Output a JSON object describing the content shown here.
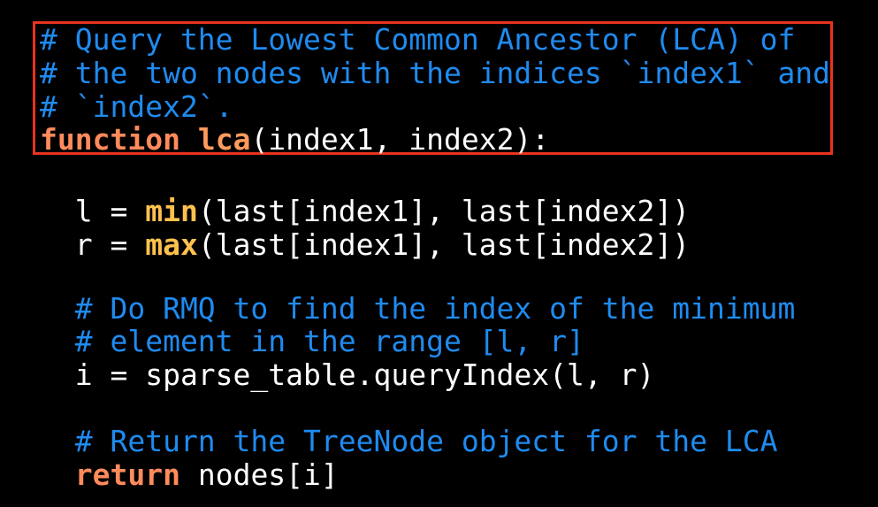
{
  "code": {
    "comment_line_1": "# Query the Lowest Common Ancestor (LCA) of",
    "comment_line_2": "# the two nodes with the indices `index1` and",
    "comment_line_3": "# `index2`.",
    "func_keyword": "function",
    "func_name": "lca",
    "func_params": "(index1, index2):",
    "l_prefix": "  l = ",
    "min_builtin": "min",
    "l_args": "(last[index1], last[index2])",
    "r_prefix": "  r = ",
    "max_builtin": "max",
    "r_args": "(last[index1], last[index2])",
    "comment_line_4": "  # Do RMQ to find the index of the minimum",
    "comment_line_5": "  # element in the range [l, r]",
    "i_line": "  i = sparse_table.queryIndex(l, r)",
    "comment_line_6": "  # Return the TreeNode object for the LCA",
    "return_indent": "  ",
    "return_keyword": "return",
    "return_value": " nodes[i]"
  },
  "colors": {
    "background": "#000000",
    "comment": "#1f8bf0",
    "keyword": "#ff8a5c",
    "builtin": "#ffc14d",
    "highlight_border": "#e8331f"
  }
}
